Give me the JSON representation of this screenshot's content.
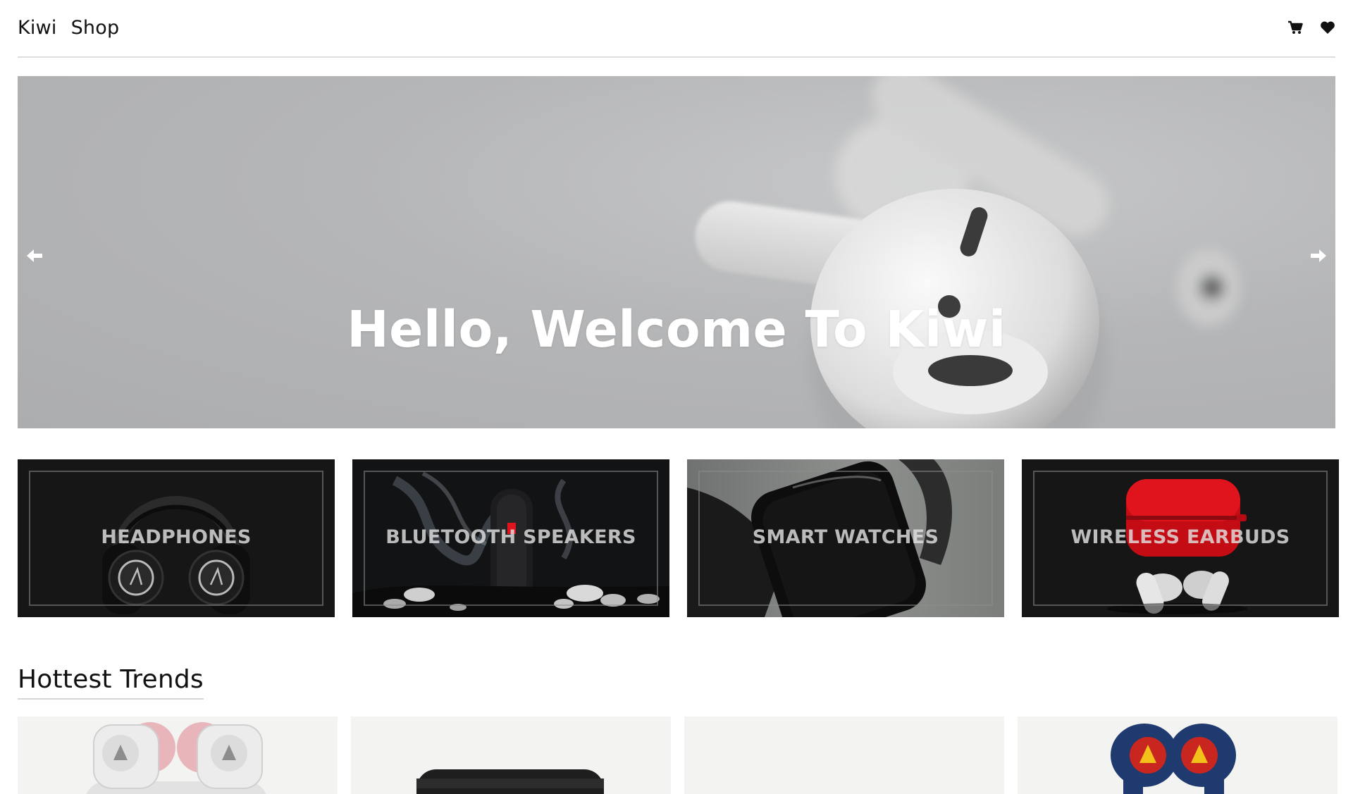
{
  "nav": {
    "brand": "Kiwi",
    "shop_link": "Shop",
    "icons": [
      "cart-icon",
      "heart-icon"
    ]
  },
  "hero": {
    "title": "Hello, Welcome To Kiwi",
    "prev_icon": "arrow-left-icon",
    "next_icon": "arrow-right-icon"
  },
  "categories": [
    {
      "label": "HEADPHONES"
    },
    {
      "label": "BLUETOOTH SPEAKERS"
    },
    {
      "label": "SMART WATCHES"
    },
    {
      "label": "WIRELESS EARBUDS"
    }
  ],
  "trends": {
    "title": "Hottest Trends"
  },
  "colors": {
    "accent_red": "#e0141c",
    "earbud_navy": "#1f3a6e",
    "earbud_pink": "#e8b5bb"
  }
}
